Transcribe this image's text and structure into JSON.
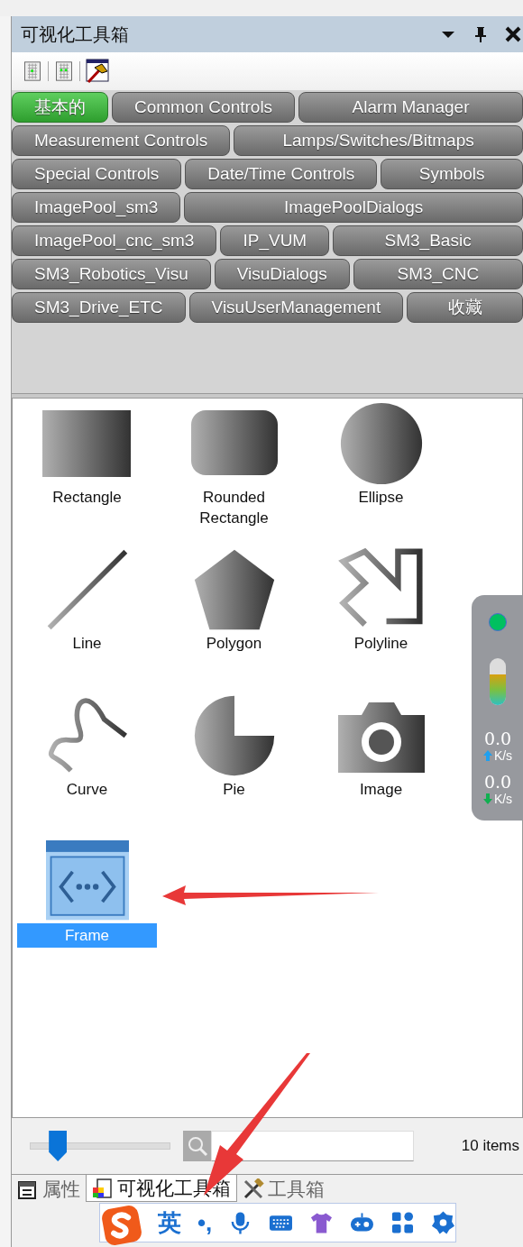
{
  "panel": {
    "title": "可视化工具箱"
  },
  "category_rows": [
    [
      {
        "label": "基本的",
        "selected": true
      },
      {
        "label": "Common Controls",
        "selected": false
      },
      {
        "label": "Alarm Manager",
        "selected": false
      }
    ],
    [
      {
        "label": "Measurement Controls",
        "selected": false
      },
      {
        "label": "Lamps/Switches/Bitmaps",
        "selected": false
      }
    ],
    [
      {
        "label": "Special Controls",
        "selected": false
      },
      {
        "label": "Date/Time Controls",
        "selected": false
      },
      {
        "label": "Symbols",
        "selected": false
      }
    ],
    [
      {
        "label": "ImagePool_sm3",
        "selected": false
      },
      {
        "label": "ImagePoolDialogs",
        "selected": false
      }
    ],
    [
      {
        "label": "ImagePool_cnc_sm3",
        "selected": false
      },
      {
        "label": "IP_VUM",
        "selected": false
      },
      {
        "label": "SM3_Basic",
        "selected": false
      }
    ],
    [
      {
        "label": "SM3_Robotics_Visu",
        "selected": false
      },
      {
        "label": "VisuDialogs",
        "selected": false
      },
      {
        "label": "SM3_CNC",
        "selected": false
      }
    ],
    [
      {
        "label": "SM3_Drive_ETC",
        "selected": false
      },
      {
        "label": "VisuUserManagement",
        "selected": false
      },
      {
        "label": "收藏",
        "selected": false
      }
    ]
  ],
  "toolbox_items": [
    {
      "kind": "rectangle",
      "label": "Rectangle",
      "selected": false
    },
    {
      "kind": "rounded",
      "label": "Rounded Rectangle",
      "selected": false
    },
    {
      "kind": "ellipse",
      "label": "Ellipse",
      "selected": false
    },
    {
      "kind": "line",
      "label": "Line",
      "selected": false
    },
    {
      "kind": "polygon",
      "label": "Polygon",
      "selected": false
    },
    {
      "kind": "polyline",
      "label": "Polyline",
      "selected": false
    },
    {
      "kind": "curve",
      "label": "Curve",
      "selected": false
    },
    {
      "kind": "pie",
      "label": "Pie",
      "selected": false
    },
    {
      "kind": "image",
      "label": "Image",
      "selected": false
    },
    {
      "kind": "frame",
      "label": "Frame",
      "selected": true
    }
  ],
  "zoom": {
    "level": 0.2
  },
  "item_count": "10 items",
  "bottom_tabs": [
    {
      "kind": "properties",
      "label": "属性",
      "selected": false
    },
    {
      "kind": "visu",
      "label": "可视化工具箱",
      "selected": true
    },
    {
      "kind": "tools",
      "label": "工具箱",
      "selected": false
    }
  ],
  "network_widget": {
    "level": 0.65,
    "upload": "0.0",
    "upload_unit": "K/s",
    "download": "0.0",
    "download_unit": "K/s"
  },
  "ime_toolbar": {
    "mode": "英",
    "punctuation": "•,"
  }
}
